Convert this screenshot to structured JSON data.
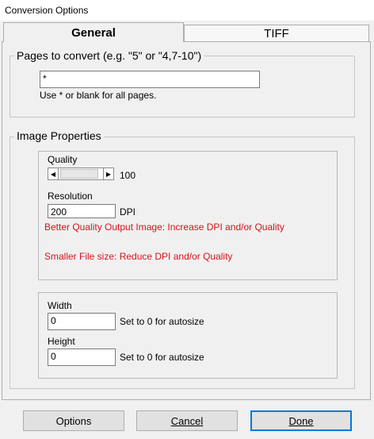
{
  "window": {
    "title": "Conversion Options"
  },
  "tabs": [
    {
      "label": "General",
      "active": true
    },
    {
      "label": "TIFF",
      "active": false
    }
  ],
  "pages_group": {
    "legend": "Pages to convert (e.g. \"5\" or \"4,7-10\")",
    "input_value": "*",
    "hint": "Use * or blank for all pages."
  },
  "image_group": {
    "legend": "Image Properties",
    "quality_label": "Quality",
    "quality_value": "100",
    "quality_level": 100,
    "resolution_label": "Resolution",
    "resolution_value": "200",
    "resolution_unit": "DPI",
    "note_quality": "Better Quality Output Image: Increase DPI and/or Quality",
    "note_size": "Smaller File size: Reduce DPI and/or Quality",
    "width_label": "Width",
    "width_value": "0",
    "width_hint": "Set to 0 for autosize",
    "height_label": "Height",
    "height_value": "0",
    "height_hint": "Set to 0 for autosize"
  },
  "buttons": {
    "options": "Options",
    "cancel": "Cancel",
    "done": "Done"
  },
  "colors": {
    "warning_text": "#d4141c",
    "accent": "#0078d7"
  }
}
